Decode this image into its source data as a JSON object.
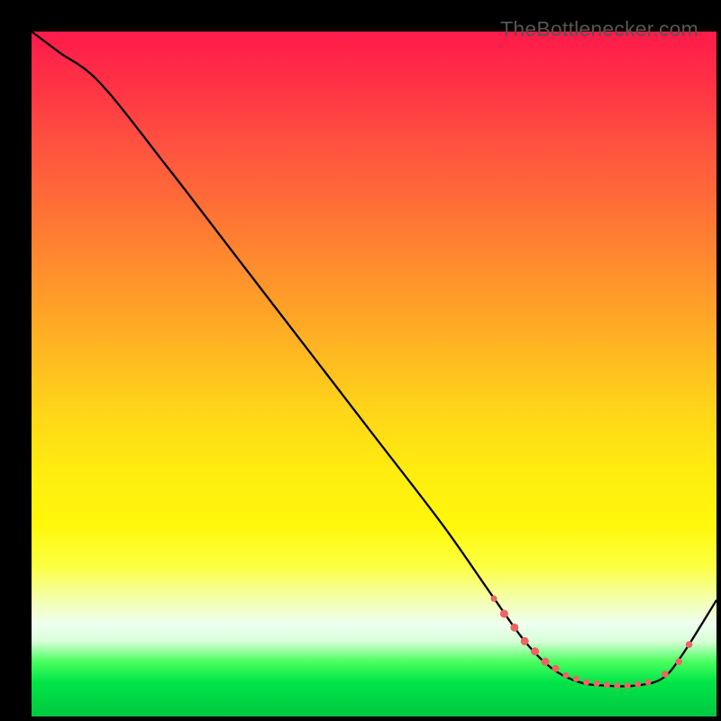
{
  "watermark": "TheBottlenecker.com",
  "chart_data": {
    "type": "line",
    "title": "",
    "xlabel": "",
    "ylabel": "",
    "xlim": [
      0,
      100
    ],
    "ylim": [
      0,
      100
    ],
    "series": [
      {
        "name": "bottleneck-curve",
        "x": [
          0,
          4,
          10,
          20,
          30,
          40,
          50,
          60,
          67,
          72,
          76,
          80,
          84,
          88,
          92,
          95,
          100
        ],
        "y": [
          100,
          97,
          92.5,
          80,
          67,
          54,
          41,
          28,
          18,
          11,
          7,
          5,
          4.5,
          4.5,
          5.5,
          9,
          17
        ],
        "color": "#000000"
      }
    ],
    "markers": {
      "color": "#ee6464",
      "points": [
        {
          "x": 67.5,
          "y": 17.2,
          "r": 3.5
        },
        {
          "x": 69,
          "y": 15,
          "r": 4.5
        },
        {
          "x": 70.5,
          "y": 13,
          "r": 4.5
        },
        {
          "x": 72,
          "y": 11,
          "r": 4.5
        },
        {
          "x": 73.5,
          "y": 9.5,
          "r": 4.5
        },
        {
          "x": 75,
          "y": 8,
          "r": 4.5
        },
        {
          "x": 76.5,
          "y": 7,
          "r": 4
        },
        {
          "x": 78,
          "y": 6,
          "r": 3.5
        },
        {
          "x": 79.5,
          "y": 5.5,
          "r": 3.5
        },
        {
          "x": 81,
          "y": 5.0,
          "r": 3.5
        },
        {
          "x": 82.5,
          "y": 4.8,
          "r": 3.5
        },
        {
          "x": 84,
          "y": 4.6,
          "r": 3.5
        },
        {
          "x": 85.5,
          "y": 4.5,
          "r": 3.5
        },
        {
          "x": 87,
          "y": 4.5,
          "r": 3.5
        },
        {
          "x": 88.5,
          "y": 4.7,
          "r": 3.5
        },
        {
          "x": 90,
          "y": 5.0,
          "r": 3.5
        },
        {
          "x": 92.5,
          "y": 6.2,
          "r": 3.8
        },
        {
          "x": 94.5,
          "y": 8.0,
          "r": 3.8
        },
        {
          "x": 96,
          "y": 10.5,
          "r": 3.8
        }
      ]
    },
    "background": {
      "type": "vertical-gradient",
      "stops": [
        {
          "pos": 0,
          "color": "#ff1a4a"
        },
        {
          "pos": 50,
          "color": "#ffc81c"
        },
        {
          "pos": 80,
          "color": "#ffff60"
        },
        {
          "pos": 92,
          "color": "#50ff60"
        },
        {
          "pos": 100,
          "color": "#00c840"
        }
      ]
    }
  }
}
